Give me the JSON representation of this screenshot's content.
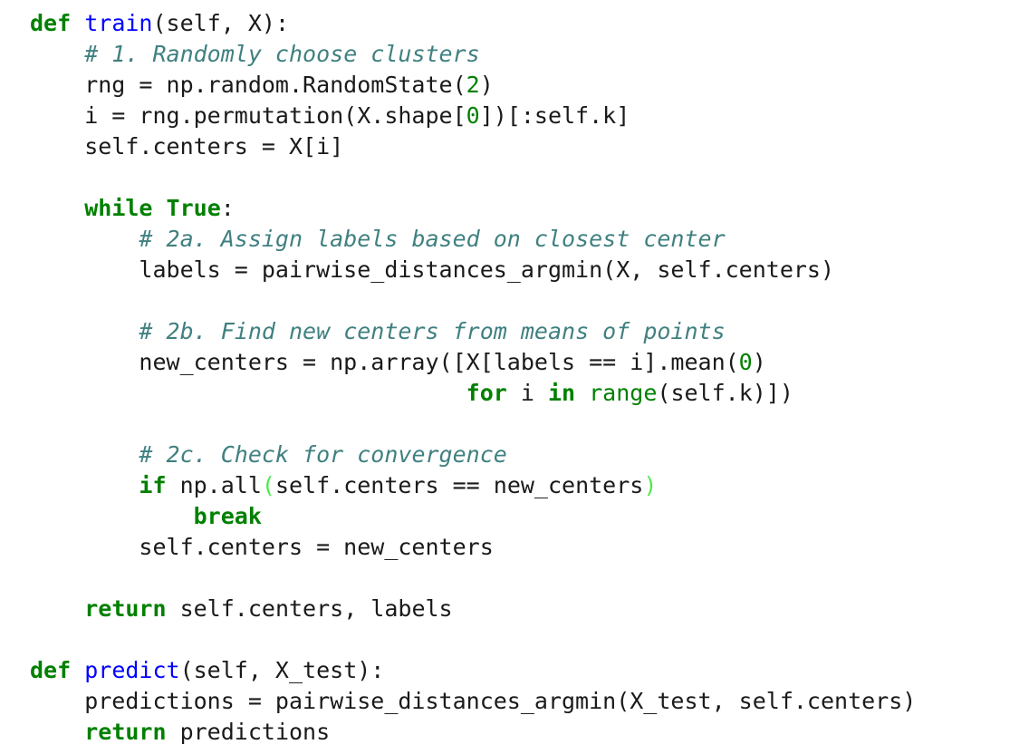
{
  "colors": {
    "keyword": "#008000",
    "function_name": "#0000ff",
    "comment": "#408080",
    "number": "#008000",
    "builtin": "#008000",
    "matching_bracket": "#4eea4e",
    "text": "#1a1a1a",
    "background": "#ffffff"
  },
  "code_lines": [
    [
      {
        "t": "kw",
        "v": "def"
      },
      {
        "t": "tx",
        "v": " "
      },
      {
        "t": "fn",
        "v": "train"
      },
      {
        "t": "tx",
        "v": "(self, X):"
      }
    ],
    [
      {
        "t": "tx",
        "v": "    "
      },
      {
        "t": "cm",
        "v": "# 1. Randomly choose clusters"
      }
    ],
    [
      {
        "t": "tx",
        "v": "    rng = np.random.RandomState("
      },
      {
        "t": "num",
        "v": "2"
      },
      {
        "t": "tx",
        "v": ")"
      }
    ],
    [
      {
        "t": "tx",
        "v": "    i = rng.permutation(X.shape["
      },
      {
        "t": "num",
        "v": "0"
      },
      {
        "t": "tx",
        "v": "])[:self.k]"
      }
    ],
    [
      {
        "t": "tx",
        "v": "    self.centers = X[i]"
      }
    ],
    [],
    [
      {
        "t": "tx",
        "v": "    "
      },
      {
        "t": "kw",
        "v": "while"
      },
      {
        "t": "tx",
        "v": " "
      },
      {
        "t": "kw",
        "v": "True"
      },
      {
        "t": "tx",
        "v": ":"
      }
    ],
    [
      {
        "t": "tx",
        "v": "        "
      },
      {
        "t": "cm",
        "v": "# 2a. Assign labels based on closest center"
      }
    ],
    [
      {
        "t": "tx",
        "v": "        labels = pairwise_distances_argmin(X, self.centers)"
      }
    ],
    [],
    [
      {
        "t": "tx",
        "v": "        "
      },
      {
        "t": "cm",
        "v": "# 2b. Find new centers from means of points"
      }
    ],
    [
      {
        "t": "tx",
        "v": "        new_centers = np.array([X[labels == i].mean("
      },
      {
        "t": "num",
        "v": "0"
      },
      {
        "t": "tx",
        "v": ")"
      }
    ],
    [
      {
        "t": "tx",
        "v": "                                "
      },
      {
        "t": "kw",
        "v": "for"
      },
      {
        "t": "tx",
        "v": " i "
      },
      {
        "t": "kw",
        "v": "in"
      },
      {
        "t": "tx",
        "v": " "
      },
      {
        "t": "bi",
        "v": "range"
      },
      {
        "t": "tx",
        "v": "(self.k)])"
      }
    ],
    [],
    [
      {
        "t": "tx",
        "v": "        "
      },
      {
        "t": "cm",
        "v": "# 2c. Check for convergence"
      }
    ],
    [
      {
        "t": "tx",
        "v": "        "
      },
      {
        "t": "kw",
        "v": "if"
      },
      {
        "t": "tx",
        "v": " np.all"
      },
      {
        "t": "bp",
        "v": "("
      },
      {
        "t": "tx",
        "v": "self.centers == new_centers"
      },
      {
        "t": "bp",
        "v": ")"
      }
    ],
    [
      {
        "t": "tx",
        "v": "            "
      },
      {
        "t": "kw",
        "v": "break"
      }
    ],
    [
      {
        "t": "tx",
        "v": "        self.centers = new_centers"
      }
    ],
    [],
    [
      {
        "t": "tx",
        "v": "    "
      },
      {
        "t": "kw",
        "v": "return"
      },
      {
        "t": "tx",
        "v": " self.centers, labels"
      }
    ],
    [],
    [
      {
        "t": "kw",
        "v": "def"
      },
      {
        "t": "tx",
        "v": " "
      },
      {
        "t": "fn",
        "v": "predict"
      },
      {
        "t": "tx",
        "v": "(self, X_test):"
      }
    ],
    [
      {
        "t": "tx",
        "v": "    predictions = pairwise_distances_argmin(X_test, self.centers)"
      }
    ],
    [
      {
        "t": "tx",
        "v": "    "
      },
      {
        "t": "kw",
        "v": "return"
      },
      {
        "t": "tx",
        "v": " predictions"
      }
    ]
  ]
}
